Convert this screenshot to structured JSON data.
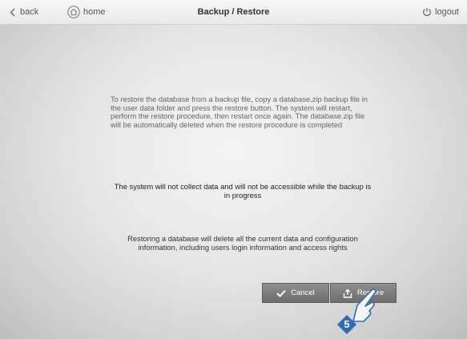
{
  "header": {
    "back_label": "back",
    "home_label": "home",
    "title": "Backup / Restore",
    "logout_label": "logout"
  },
  "messages": {
    "restore_instructions": "To restore the database from a backup file, copy a database.zip backup file in the user data folder and press the restore button. The system will restart, perform the restore procedure, then restart once again. The database.zip file will be automatically deleted when the restore procedure is completed",
    "backup_notice": "The system will not collect data and will not be accessible while the backup is in progress",
    "restore_warning": "Restoring a database will delete all the current data and configuration information, including users login information and access rights"
  },
  "buttons": {
    "cancel_label": "Cancel",
    "restore_label": "Restore"
  },
  "callout": {
    "step_number": "5"
  },
  "colors": {
    "button_bg": "#7d7d7d",
    "callout_blue": "#2d6db5"
  },
  "icons": {
    "back": "chevron-left-icon",
    "home": "home-icon",
    "logout": "power-icon",
    "cancel": "checkmark-icon",
    "restore": "upload-icon",
    "pointer": "hand-pointer-icon"
  }
}
